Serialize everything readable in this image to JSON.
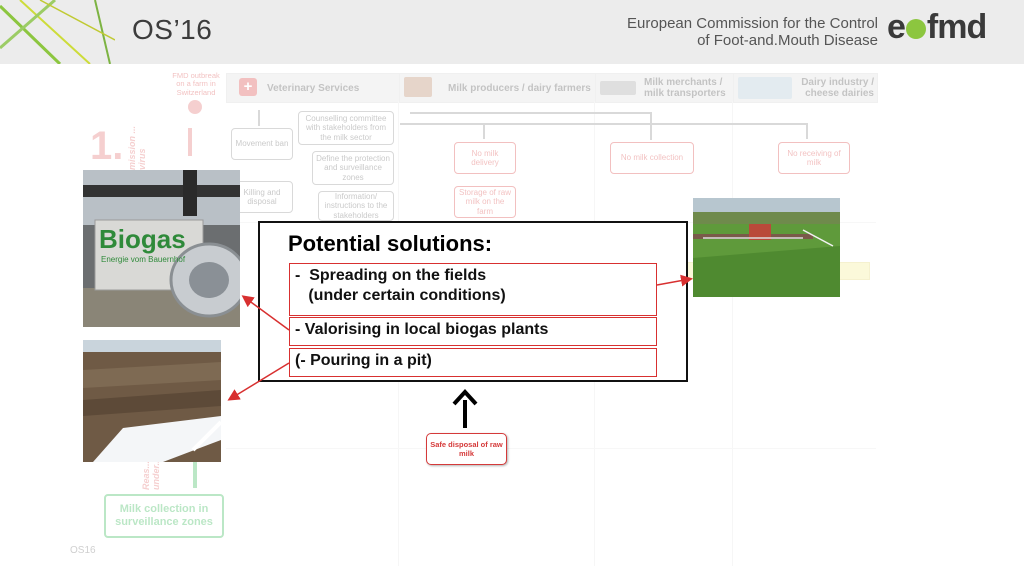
{
  "header": {
    "title": "OS’16",
    "org_line1": "European Commission for the Control",
    "org_line2": "of Foot-and.Mouth Disease",
    "brand": "eufmd"
  },
  "lanes": [
    {
      "label": "Veterinary Services"
    },
    {
      "label": "Milk producers / dairy farmers"
    },
    {
      "label": "Milk merchants / milk transporters"
    },
    {
      "label": "Dairy industry / cheese dairies"
    }
  ],
  "diagram": {
    "trigger": "FMD outbreak on a farm in Switzerland",
    "step_number": "1.",
    "step_side": "mission ... virus",
    "boxes": {
      "movement_ban": "Movement ban",
      "killing_disposal": "Killing and disposal",
      "counselling": "Counselling committee with stakeholders from the milk sector",
      "define_zones": "Define the protection and surveillance zones",
      "information": "Information/ instructions to the stakeholders",
      "no_milk_delivery": "No milk delivery",
      "storage_raw_milk": "Storage of raw milk on the farm",
      "no_milk_collection": "No milk collection",
      "no_receiving": "No receiving of milk"
    },
    "milk_collection_zones": "Milk collection in surveillance zones",
    "left_vertical": "Reas... under..."
  },
  "solutions": {
    "title": "Potential solutions:",
    "items": [
      "-  Spreading on the fields\n   (under certain conditions)",
      "-  Valorising in local biogas plants",
      "(- Pouring in a pit)"
    ]
  },
  "safe_disposal": "Safe disposal of raw milk",
  "photos": {
    "biogas_sign_line1": "Biogas",
    "biogas_sign_line2": "Energie vom Bauernhof"
  },
  "footer": "OS16",
  "colors": {
    "accent_red": "#d53a3a",
    "green": "#2bb24c",
    "brand_green": "#8cc63f"
  }
}
